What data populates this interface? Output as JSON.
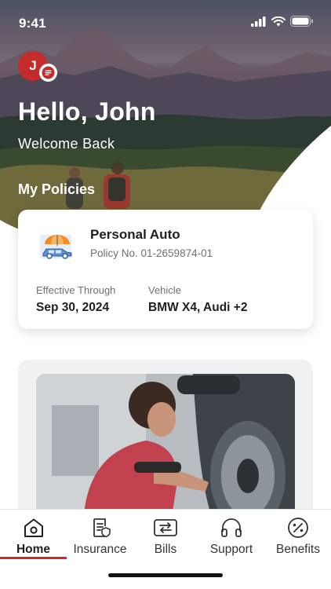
{
  "status_bar": {
    "time": "9:41"
  },
  "user": {
    "initial": "J"
  },
  "header": {
    "greeting": "Hello, John",
    "subtitle": "Welcome Back",
    "section_title": "My Policies"
  },
  "policy": {
    "name": "Personal Auto",
    "number": "Policy No. 01-2659874-01",
    "effective_label": "Effective Through",
    "effective_value": "Sep 30, 2024",
    "vehicle_label": "Vehicle",
    "vehicle_value": "BMW X4, Audi +2",
    "icon": "car-umbrella-icon"
  },
  "tabs": [
    {
      "label": "Home",
      "icon": "home-icon",
      "active": true
    },
    {
      "label": "Insurance",
      "icon": "document-shield-icon",
      "active": false
    },
    {
      "label": "Bills",
      "icon": "bills-swap-icon",
      "active": false
    },
    {
      "label": "Support",
      "icon": "headphones-icon",
      "active": false
    },
    {
      "label": "Benefits",
      "icon": "percent-badge-icon",
      "active": false
    }
  ],
  "colors": {
    "accent": "#c62b2b",
    "text": "#1f1f1f",
    "muted": "#707070"
  }
}
